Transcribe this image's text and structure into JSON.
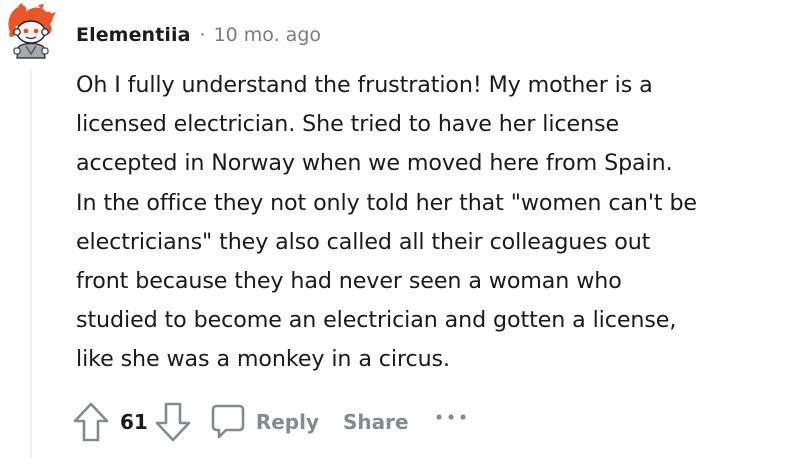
{
  "comment": {
    "author": "Elementiia",
    "separator": "·",
    "time_ago": "10 mo. ago",
    "body_lines": [
      "Oh I fully understand the frustration! My mother is a",
      "licensed electrician. She tried to have her license",
      "accepted in Norway when we moved here from Spain.",
      "In the office they not only told her that \"women can't be",
      "electricians\" they also called all their colleagues out",
      "front because they had never seen a woman who",
      "studied to become an electrician and gotten a license,",
      "like she was a monkey in a circus."
    ]
  },
  "actions": {
    "vote_count": "61",
    "reply_label": "Reply",
    "share_label": "Share"
  },
  "icons": {
    "upvote": "upvote-arrow-icon",
    "downvote": "downvote-arrow-icon",
    "reply": "speech-bubble-icon",
    "more": "ellipsis-icon",
    "avatar": "snoo-avatar-icon"
  },
  "colors": {
    "text": "#1a1a1b",
    "muted": "#878a8c",
    "meta": "#7c7c7c",
    "thread_line": "#edeff1",
    "avatar_hair": "#e8562a"
  }
}
